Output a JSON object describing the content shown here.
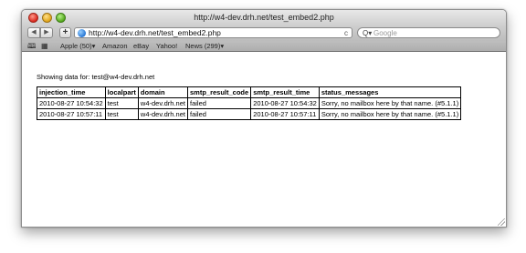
{
  "window": {
    "title": "http://w4-dev.drh.net/test_embed2.php"
  },
  "toolbar": {
    "back_icon": "back-arrow-icon",
    "forward_icon": "forward-arrow-icon",
    "add_label": "+",
    "url": "http://w4-dev.drh.net/test_embed2.php",
    "reload_glyph": "c",
    "search_placeholder": "Google"
  },
  "bookmarks": {
    "items": [
      {
        "label": "Apple (50)▾"
      },
      {
        "label": "Amazon"
      },
      {
        "label": "eBay"
      },
      {
        "label": "Yahoo!"
      },
      {
        "label": "News (299)▾"
      }
    ]
  },
  "page": {
    "showing_text": "Showing data for: test@w4-dev.drh.net",
    "table": {
      "headers": [
        "injection_time",
        "localpart",
        "domain",
        "smtp_result_code",
        "smtp_result_time",
        "status_messages"
      ],
      "rows": [
        [
          "2010-08-27 10:54:32",
          "test",
          "w4-dev.drh.net",
          "failed",
          "2010-08-27 10:54:32",
          "Sorry, no mailbox here by that name. (#5.1.1)"
        ],
        [
          "2010-08-27 10:57:11",
          "test",
          "w4-dev.drh.net",
          "failed",
          "2010-08-27 10:57:11",
          "Sorry, no mailbox here by that name. (#5.1.1)"
        ]
      ]
    }
  },
  "colors": {
    "close": "#d9261c",
    "minimize": "#e0a316",
    "zoom": "#53a81b",
    "globe": "#1e6fd1"
  }
}
